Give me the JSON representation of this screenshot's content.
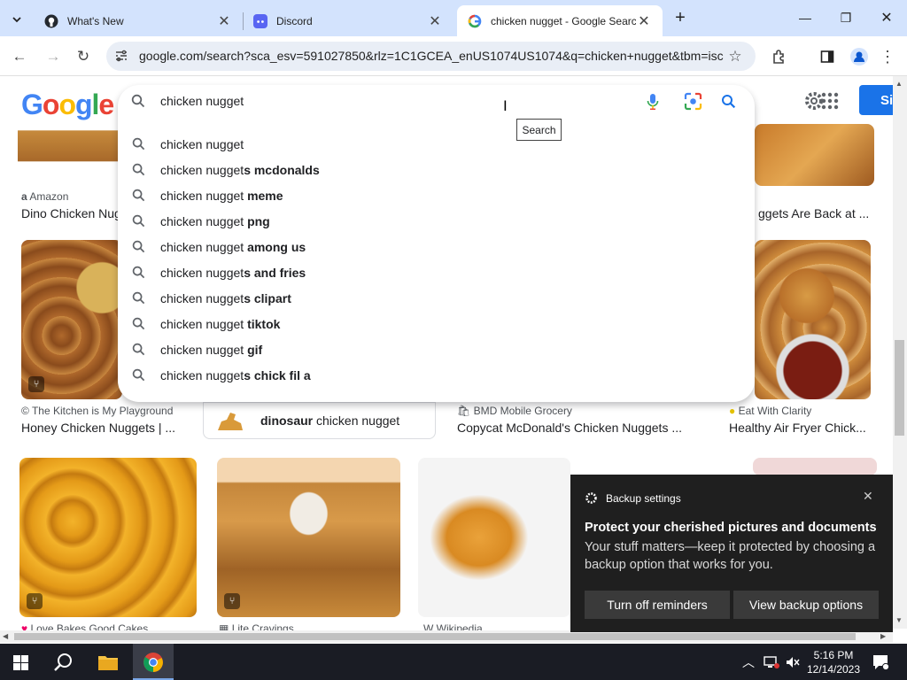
{
  "tabs": [
    {
      "title": "What's New",
      "icon": "github-icon"
    },
    {
      "title": "Discord",
      "icon": "discord-icon"
    },
    {
      "title": "chicken nugget - Google Search",
      "icon": "google-icon"
    }
  ],
  "toolbar": {
    "url": "google.com/search?sca_esv=591027850&rlz=1C1GCEA_enUS1074US1074&q=chicken+nugget&tbm=isch"
  },
  "google": {
    "logo_text": "Google",
    "query": "chicken nugget",
    "tooltip": "Search",
    "signin_label": "Si"
  },
  "suggestions": [
    {
      "base": "chicken nugget",
      "bold": ""
    },
    {
      "base": "chicken nugget",
      "bold": "s mcdonalds"
    },
    {
      "base": "chicken nugget",
      "bold": " meme"
    },
    {
      "base": "chicken nugget",
      "bold": " png"
    },
    {
      "base": "chicken nugget",
      "bold": " among us"
    },
    {
      "base": "chicken nugget",
      "bold": "s and fries"
    },
    {
      "base": "chicken nugget",
      "bold": "s clipart"
    },
    {
      "base": "chicken nugget",
      "bold": " tiktok"
    },
    {
      "base": "chicken nugget",
      "bold": " gif"
    },
    {
      "base": "chicken nugget",
      "bold": "s chick fil a"
    }
  ],
  "results": {
    "row1": [
      {
        "source": "Amazon",
        "caption": "Dino Chicken Nug"
      },
      {
        "source": "",
        "caption": "ggets Are Back at ..."
      }
    ],
    "row2": [
      {
        "source": "The Kitchen is My Playground",
        "caption": "Honey Chicken Nuggets | ..."
      },
      {
        "chip_bold": "dinosaur",
        "chip_rest": " chicken nugget"
      },
      {
        "source": "BMD Mobile Grocery",
        "caption": "Copycat McDonald's Chicken Nuggets ..."
      },
      {
        "source": "Eat With Clarity",
        "caption": "Healthy Air Fryer Chick..."
      }
    ],
    "row3": [
      {
        "source": "Love Bakes Good Cakes"
      },
      {
        "source": "Lite Cravings"
      },
      {
        "source": "Wikipedia"
      }
    ]
  },
  "notification": {
    "app": "Backup settings",
    "title": "Protect your cherished pictures and documents",
    "body": "Your stuff matters—keep it protected by choosing a backup option that works for you.",
    "btn1": "Turn off reminders",
    "btn2": "View backup options"
  },
  "taskbar": {
    "time": "5:16 PM",
    "date": "12/14/2023"
  },
  "colors": {
    "tabbar": "#d3e3fd",
    "google_blue": "#1a73e8",
    "notif_bg": "#1f1f1f"
  }
}
